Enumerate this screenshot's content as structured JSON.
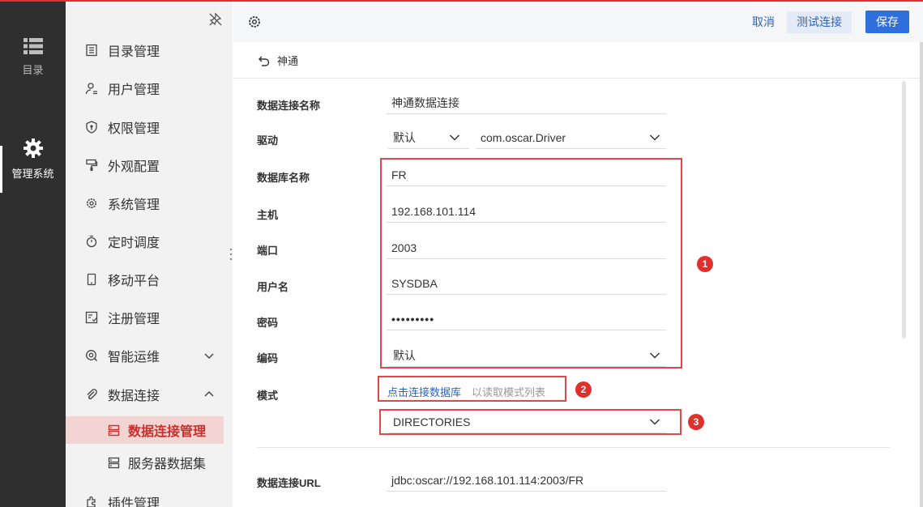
{
  "rail": {
    "items": [
      {
        "label": "目录",
        "icon": "list-icon"
      },
      {
        "label": "管理系统",
        "icon": "gear-icon"
      }
    ]
  },
  "menu": {
    "items": [
      {
        "label": "目录管理",
        "icon": "catalog-icon"
      },
      {
        "label": "用户管理",
        "icon": "user-icon"
      },
      {
        "label": "权限管理",
        "icon": "shield-icon"
      },
      {
        "label": "外观配置",
        "icon": "paint-roller-icon"
      },
      {
        "label": "系统管理",
        "icon": "gear-icon"
      },
      {
        "label": "定时调度",
        "icon": "stopwatch-icon"
      },
      {
        "label": "移动平台",
        "icon": "mobile-icon"
      },
      {
        "label": "注册管理",
        "icon": "register-icon"
      },
      {
        "label": "智能运维",
        "icon": "ops-icon"
      },
      {
        "label": "数据连接",
        "icon": "paperclip-icon"
      },
      {
        "label": "插件管理",
        "icon": "plugin-icon"
      }
    ],
    "subitems": [
      {
        "label": "数据连接管理",
        "icon": "database-icon"
      },
      {
        "label": "服务器数据集",
        "icon": "server-dataset-icon"
      }
    ]
  },
  "toolbar": {
    "cancel": "取消",
    "test": "测试连接",
    "save": "保存"
  },
  "back": {
    "label": "神通"
  },
  "form": {
    "name_label": "数据连接名称",
    "name_value": "神通数据连接",
    "driver_label": "驱动",
    "driver_mode": "默认",
    "driver_class": "com.oscar.Driver",
    "db_label": "数据库名称",
    "db_value": "FR",
    "host_label": "主机",
    "host_value": "192.168.101.114",
    "port_label": "端口",
    "port_value": "2003",
    "user_label": "用户名",
    "user_value": "SYSDBA",
    "password_label": "密码",
    "password_value": "•••••••••",
    "encoding_label": "编码",
    "encoding_value": "默认",
    "schema_label": "模式",
    "schema_link": "点击连接数据库",
    "schema_hint": "以读取模式列表",
    "schema_value": "DIRECTORIES",
    "url_label": "数据连接URL",
    "url_value": "jdbc:oscar://192.168.101.114:2003/FR"
  },
  "annotations": [
    "1",
    "2",
    "3"
  ],
  "colors": {
    "accent": "#2e6fdb",
    "active_menu_bg": "#f2d4d3",
    "active_menu_text": "#c9302c",
    "annotation_red": "#e0302e",
    "rail_bg": "#2f2f2f"
  }
}
